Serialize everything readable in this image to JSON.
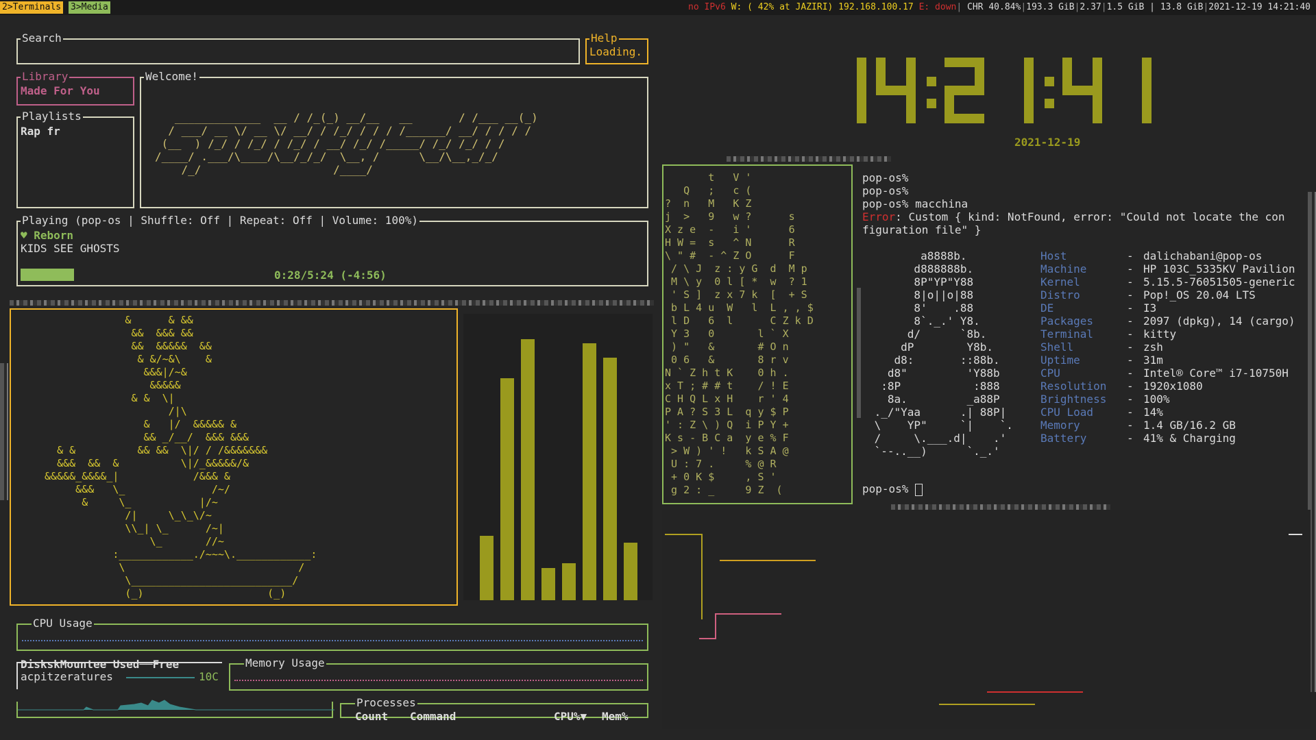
{
  "workspaces": [
    {
      "label": "2>Terminals",
      "color": "#f0b429"
    },
    {
      "label": "3>Media",
      "color": "#8fbc5a"
    }
  ],
  "status": {
    "ipv6": "no IPv6",
    "wifi": "W: ( 42% at JAZIRI) 192.168.100.17",
    "eth": "E: down",
    "chr": "CHR 40.84%",
    "disk": "193.3 GiB",
    "load": "2.37",
    "mem": "1.5 GiB | 13.8 GiB",
    "datetime": "2021-12-19 14:21:40"
  },
  "spotify": {
    "search_label": "Search",
    "help_label": "Help",
    "help_text": "Loading.",
    "library_label": "Library",
    "library_item": "Made For You",
    "playlists_label": "Playlists",
    "playlist_item": "Rap fr",
    "welcome_label": "Welcome!",
    "welcome_art": "   _____________  __ / /_(_) __/__   __       / /___ __(_)\n  / ___/ __ \\/ __ \\/ __/ / /_/ / / / /______/ __/ / / / /\n (__  ) /_/ / /_/ / /_/ / __/ /_/ /_____/ /_/ /_/ / /\n/____/ .___/\\____/\\__/_/_/  \\__, /      \\__/\\__,_/_/\n    /_/                    /____/",
    "playing_label": "Playing (pop-os | Shuffle: Off | Repeat: Off   | Volume: 100%)",
    "track": "♥ Reborn",
    "artist": "KIDS SEE GHOSTS",
    "progress_text": "0:28/5:24 (-4:56)",
    "progress_fraction": 0.0864
  },
  "bonsai_art": "              &      & &&\n               &&  &&& &&\n               &&  &&&&&  &&\n                & &/~&\\    &\n                 &&&|/~&\n                  &&&&&\n               & &  \\|\n                     /|\\\n                 &   |/  &&&&& &\n                 && _/__/  &&& &&&\n   & &          && &&  \\|/ / /&&&&&&&\n   &&&  &&  &          \\|/_&&&&&/&\n &&&&&_&&&&_|            /&&& &\n      &&&   \\_              /~/\n       &     \\_           |/~\n              /|     \\_\\_\\/~\n              \\\\_| \\_      /~|\n                  \\_       //~\n            :____________./~~~\\.____________:\n             \\                            /\n              \\__________________________/\n              (_)                    (_)",
  "visualizer": {
    "values": [
      0.28,
      0.97,
      1.14,
      0.14,
      0.16,
      1.12,
      1.06,
      0.25
    ],
    "max": 1.2
  },
  "clock": {
    "time": "14:21:41",
    "date": "2021-12-19"
  },
  "matrix": {
    "text": "       t   V '\n   Q   ;   c (\n?  n   M   K Z\nj  >   9   w ?      s\nX z e  -   i '      6\nH W =  s   ^ N      R\n\\ \" #  - ^ Z O      F\n / \\ J  z : y G  d  M p\n M \\ y  0 l [ *  w  ? 1\n ' S ]  z x 7 k  [  + S\n b L 4 u  W   l  L , , $\n l D   6  l      C Z k D\n Y 3   0       l ` X\n ) \"   &       # O n\n 0 6   &       8 r v\nN ` Z h t K    0 h .\nx T ; # # t    / ! E\nC H Q L x H    r ' 4\nP A ? S 3 L  q y $ P\n' : Z \\ ) Q  i P Y +\nK s - B C a  y e % F\n > W ) ' !   k S A @\n U : 7 .     % @ R\n + 0 K $     , S '\n g 2 : _     9 Z  ("
  },
  "terminal": {
    "lines": [
      "pop-os%",
      "pop-os%",
      "pop-os% macchina"
    ],
    "error_word": "Error",
    "error_rest": ": Custom { kind: NotFound, error: \"Could not locate the con",
    "error_line2": "figuration file\" }",
    "ascii_art": "        a8888b.\n       d888888b.\n       8P\"YP\"Y88\n       8|o||o|88\n       8'    .88\n       8`._.' Y8.\n      d/      `8b.\n     dP        Y8b.\n    d8:       ::88b.\n   d8\"         'Y88b\n  :8P           :888\n   8a.         _a88P\n ._/\"Yaa      .| 88P|\n \\    YP\"     `|    `.\n /     \\.___.d|    .'\n `--..__)      `._.'",
    "info": [
      {
        "key": "Host",
        "value": "dalichabani@pop-os"
      },
      {
        "key": "Machine",
        "value": "HP 103C_5335KV Pavilion"
      },
      {
        "key": "Kernel",
        "value": "5.15.5-76051505-generic"
      },
      {
        "key": "Distro",
        "value": "Pop!_OS 20.04 LTS"
      },
      {
        "key": "DE",
        "value": "I3"
      },
      {
        "key": "Packages",
        "value": "2097 (dpkg), 14 (cargo)"
      },
      {
        "key": "Terminal",
        "value": "kitty"
      },
      {
        "key": "Shell",
        "value": "zsh"
      },
      {
        "key": "Uptime",
        "value": "31m"
      },
      {
        "key": "CPU",
        "value": "Intel® Core™ i7-10750H"
      },
      {
        "key": "Resolution",
        "value": "1920x1080"
      },
      {
        "key": "Brightness",
        "value": "100%"
      },
      {
        "key": "CPU Load",
        "value": "14%"
      },
      {
        "key": "Memory",
        "value": "1.4 GB/16.2 GB"
      },
      {
        "key": "Battery",
        "value": "41% & Charging"
      }
    ],
    "dash": "-",
    "prompt": "pop-os%"
  },
  "monitor": {
    "cpu_label": "CPU Usage",
    "disks_header": [
      "Disk",
      "skMounte",
      "e Used",
      "Free"
    ],
    "disk_row": "acpitzeratures",
    "temp": "10C",
    "memory_label": "Memory Usage",
    "processes_label": "Processes",
    "proc_cols": [
      "Count",
      "Command",
      "CPU%▼",
      "Mem%"
    ]
  },
  "colors": {
    "yellow": "#f0b429",
    "olive": "#9a9a1e",
    "green": "#8fbc5a",
    "pink": "#c0608a",
    "red": "#d03030",
    "teal": "#3a8a8a",
    "blue_key": "#5a7ab8"
  }
}
